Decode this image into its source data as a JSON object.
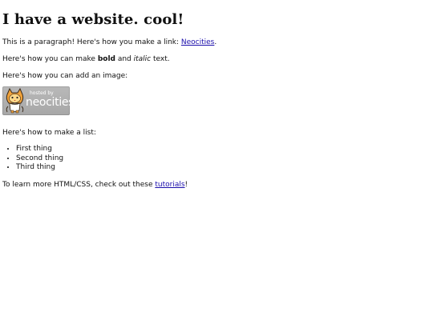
{
  "page": {
    "heading": "I have a website. cool!",
    "p1": {
      "text": "This is a paragraph! Here's how you make a link: ",
      "link": "Neocities",
      "after": "."
    },
    "p2": {
      "before": "Here's how you can make ",
      "bold": "bold",
      "middle": " and ",
      "italic": "italic",
      "after": " text."
    },
    "p3": "Here's how you can add an image:",
    "badge": {
      "hosted": "hosted by",
      "brand": "neocities"
    },
    "p4": "Here's how to make a list:",
    "list": [
      "First thing",
      "Second thing",
      "Third thing"
    ],
    "p5": {
      "before": "To learn more HTML/CSS, check out these ",
      "link": "tutorials",
      "after": "!"
    }
  }
}
